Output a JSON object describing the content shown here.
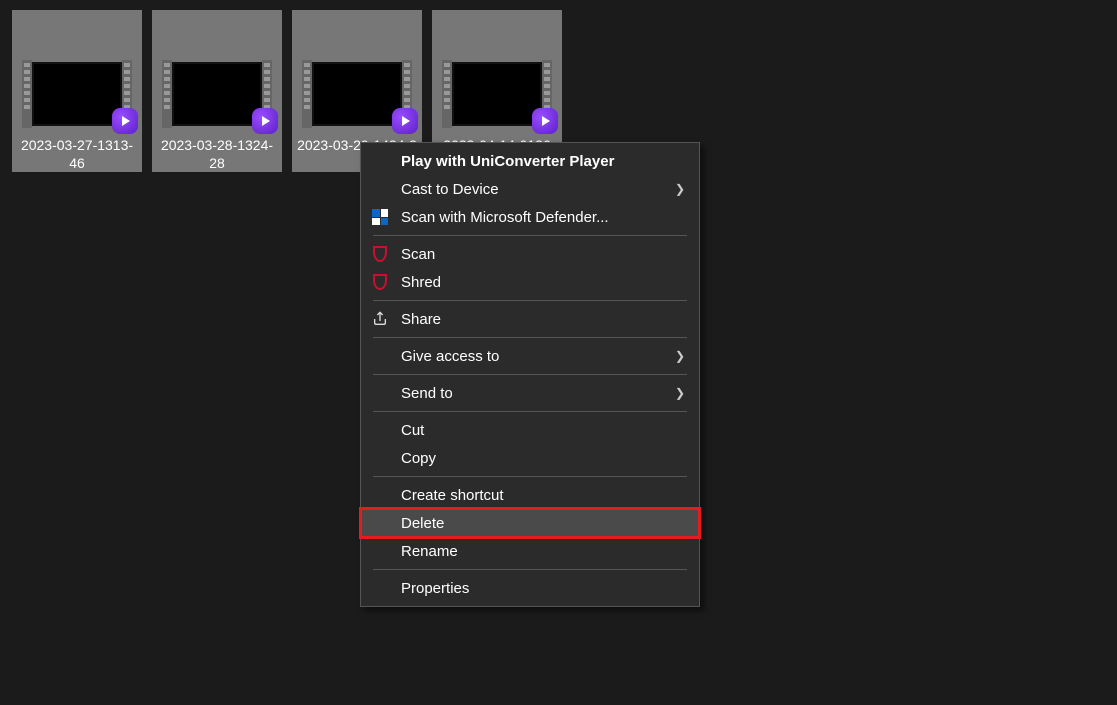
{
  "files": [
    {
      "name": "2023-03-27-1313-46"
    },
    {
      "name": "2023-03-28-1324-28"
    },
    {
      "name": "2023-03-29-1424-3"
    },
    {
      "name": "2023-04-14-0126"
    }
  ],
  "context_menu": {
    "play_uniconverter": "Play with UniConverter Player",
    "cast_to_device": "Cast to Device",
    "scan_defender": "Scan with Microsoft Defender...",
    "scan": "Scan",
    "shred": "Shred",
    "share": "Share",
    "give_access_to": "Give access to",
    "send_to": "Send to",
    "cut": "Cut",
    "copy": "Copy",
    "create_shortcut": "Create shortcut",
    "delete": "Delete",
    "rename": "Rename",
    "properties": "Properties"
  }
}
